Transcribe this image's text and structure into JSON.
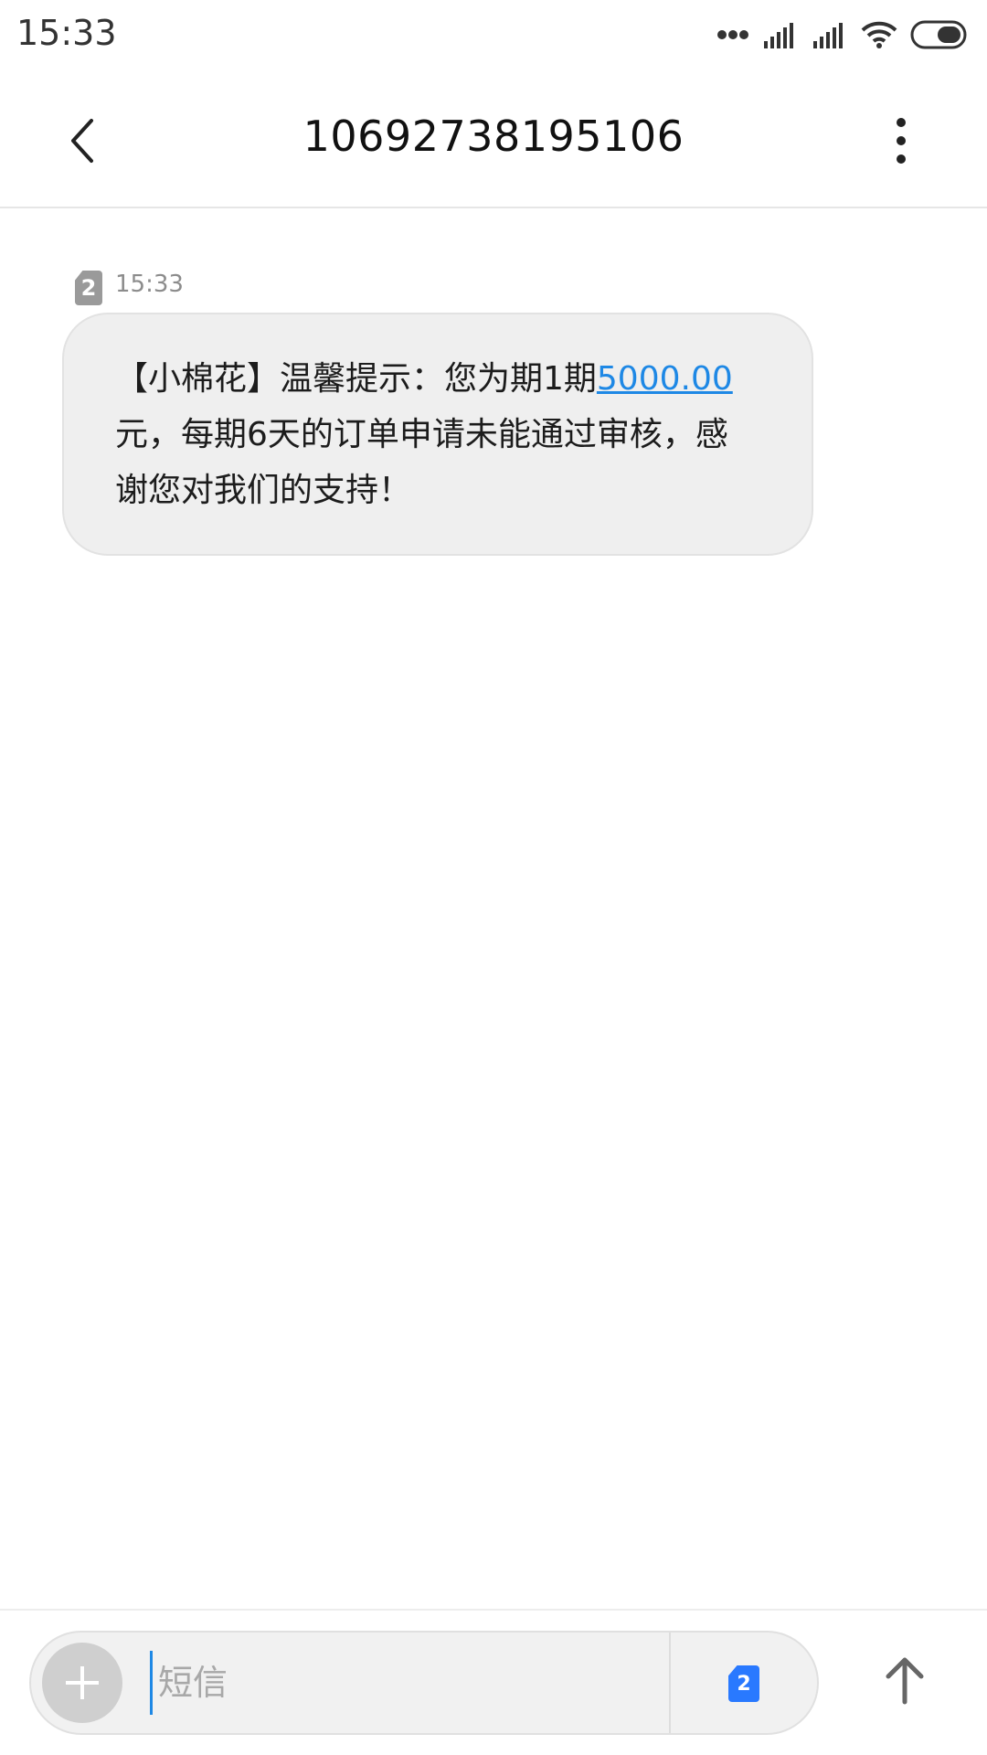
{
  "status_bar": {
    "time": "15:33"
  },
  "header": {
    "title": "10692738195106"
  },
  "message": {
    "sim_slot": "2",
    "time": "15:33",
    "text_before": "【小棉花】温馨提示：您为期1期",
    "amount": "5000.00",
    "text_after": "元，每期6天的订单申请未能通过审核，感谢您对我们的支持！"
  },
  "composer": {
    "placeholder": "短信",
    "sim_slot": "2"
  },
  "colors": {
    "accent": "#1e88e5",
    "bubble": "#efefef",
    "sim_select": "#2979ff"
  },
  "icons": {
    "back": "back-icon",
    "more": "more-vertical-icon",
    "add": "plus-icon",
    "send": "arrow-up-icon"
  }
}
